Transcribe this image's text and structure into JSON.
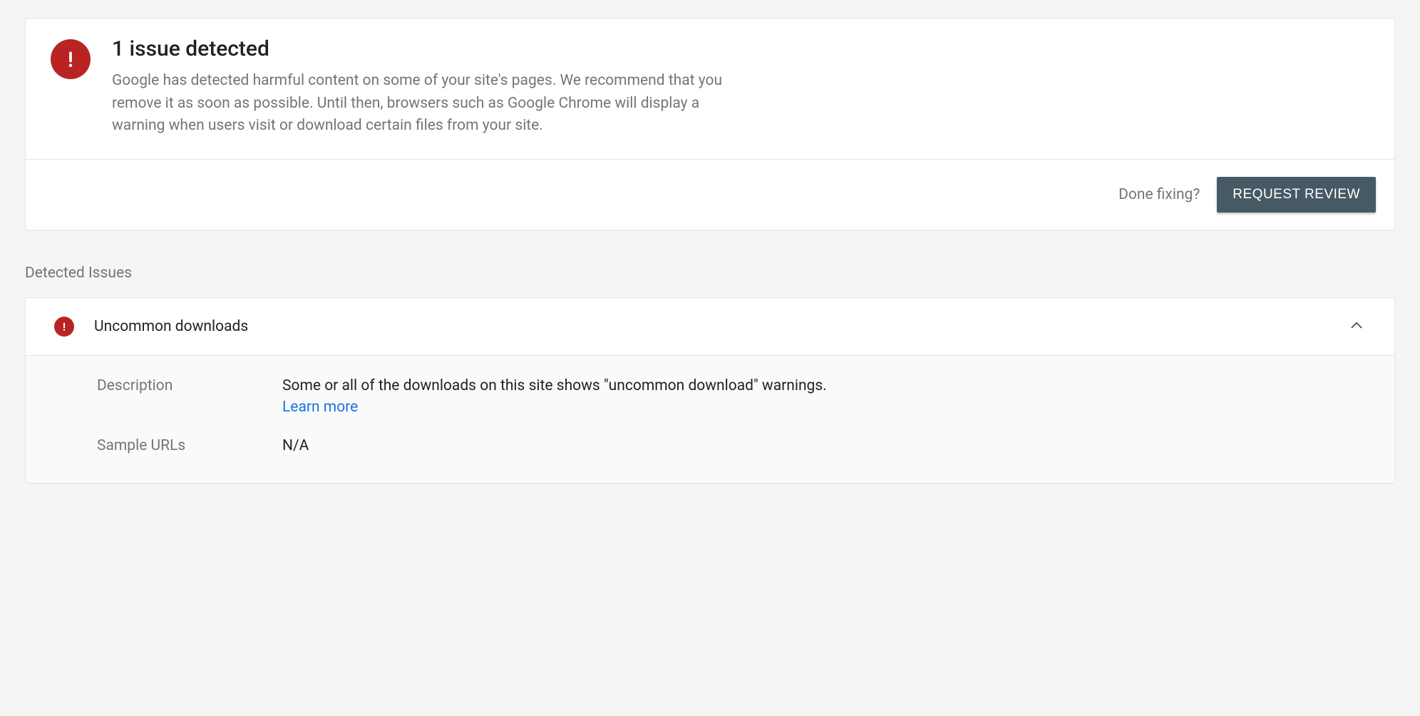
{
  "issue": {
    "title": "1 issue detected",
    "description": "Google has detected harmful content on some of your site's pages. We recommend that you remove it as soon as possible. Until then, browsers such as Google Chrome will display a warning when users visit or download certain files from your site.",
    "done_fixing_label": "Done fixing?",
    "request_review_label": "REQUEST REVIEW"
  },
  "detected_section_title": "Detected Issues",
  "accordion": {
    "title": "Uncommon downloads",
    "description_label": "Description",
    "description_value": "Some or all of the downloads on this site shows \"uncommon download\" warnings.",
    "learn_more_label": "Learn more",
    "sample_urls_label": "Sample URLs",
    "sample_urls_value": "N/A"
  }
}
